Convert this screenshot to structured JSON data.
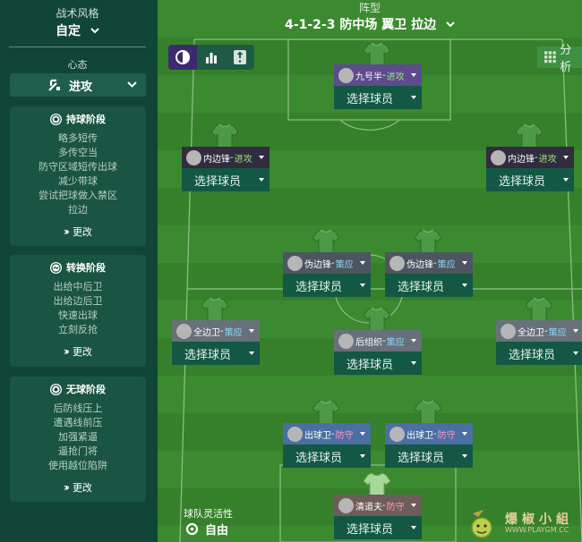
{
  "sidebar": {
    "tactic_style_label": "战术风格",
    "tactic_style_value": "自定",
    "mentality_label": "心态",
    "mentality_value": "进攻",
    "phases": [
      {
        "title": "持球阶段",
        "icon": "football-icon",
        "items": [
          "略多短传",
          "多传空当",
          "防守区域短传出球",
          "减少带球",
          "尝试把球做入禁区",
          "拉边"
        ],
        "change_label": "更改"
      },
      {
        "title": "转换阶段",
        "icon": "transition-icon",
        "items": [
          "出给中后卫",
          "出给边后卫",
          "快速出球",
          "立刻反抢"
        ],
        "change_label": "更改"
      },
      {
        "title": "无球阶段",
        "icon": "out-of-possession-icon",
        "items": [
          "后防线压上",
          "遭遇线前压",
          "加强紧逼",
          "逼抢门将",
          "使用越位陷阱"
        ],
        "change_label": "更改"
      }
    ]
  },
  "formation": {
    "label": "阵型",
    "value": "4-1-2-3 防中场 翼卫 拉边"
  },
  "view_buttons": [
    "overview-icon",
    "bar-chart-icon",
    "info-icon"
  ],
  "analysis_label": "分析",
  "players": [
    {
      "id": "st",
      "role": "九号半",
      "duty": "进攻",
      "duty_color": "#9be07a",
      "select_label": "选择球员"
    },
    {
      "id": "lw",
      "role": "内边锋",
      "duty": "进攻",
      "duty_color": "#9be07a",
      "select_label": "选择球员"
    },
    {
      "id": "rw",
      "role": "内边锋",
      "duty": "进攻",
      "duty_color": "#9be07a",
      "select_label": "选择球员"
    },
    {
      "id": "lcm",
      "role": "伪边锋",
      "duty": "策应",
      "duty_color": "#8fd8ff",
      "select_label": "选择球员"
    },
    {
      "id": "rcm",
      "role": "伪边锋",
      "duty": "策应",
      "duty_color": "#8fd8ff",
      "select_label": "选择球员"
    },
    {
      "id": "lwb",
      "role": "全边卫",
      "duty": "策应",
      "duty_color": "#8fd8ff",
      "select_label": "选择球员"
    },
    {
      "id": "dm",
      "role": "后组织",
      "duty": "策应",
      "duty_color": "#8fd8ff",
      "select_label": "选择球员"
    },
    {
      "id": "rwb",
      "role": "全边卫",
      "duty": "策应",
      "duty_color": "#8fd8ff",
      "select_label": "选择球员"
    },
    {
      "id": "lcb",
      "role": "出球卫",
      "duty": "防守",
      "duty_color": "#ff9ac4",
      "select_label": "选择球员"
    },
    {
      "id": "rcb",
      "role": "出球卫",
      "duty": "防守",
      "duty_color": "#ff9ac4",
      "select_label": "选择球员"
    },
    {
      "id": "gk",
      "role": "清道夫",
      "duty": "防守",
      "duty_color": "#ff9ac4",
      "select_label": "选择球员"
    }
  ],
  "team_fluidity": {
    "label": "球队灵活性",
    "value": "自由"
  },
  "watermark": {
    "text": "爆椒小組",
    "sub": "WWW.PLAYGM.CC"
  },
  "colors": {
    "attack": "#9be07a",
    "support": "#8fd8ff",
    "defend": "#ff9ac4",
    "accent": "#3c2a6e"
  }
}
